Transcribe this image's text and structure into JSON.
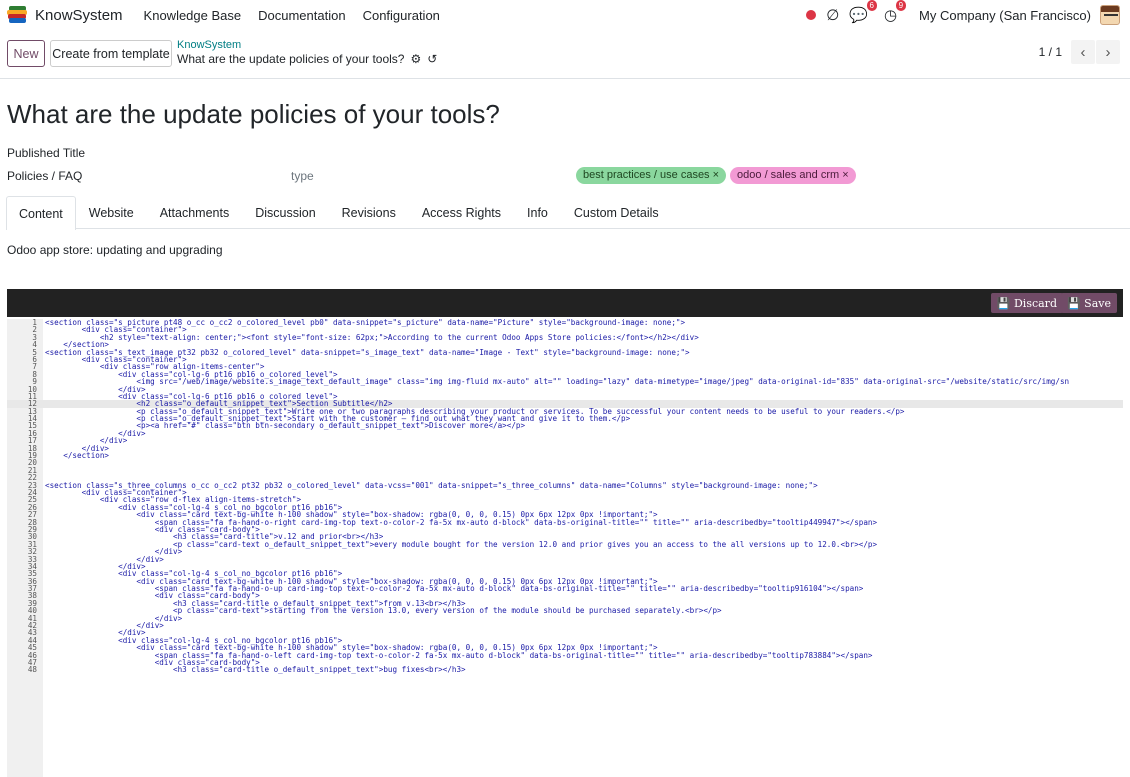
{
  "navbar": {
    "brand": "KnowSystem",
    "menu": [
      "Knowledge Base",
      "Documentation",
      "Configuration"
    ],
    "chat_badge": "6",
    "activity_badge": "9",
    "company": "My Company (San Francisco)"
  },
  "control": {
    "new_label": "New",
    "template_label": "Create from template",
    "breadcrumb_parent": "KnowSystem",
    "breadcrumb_current": "What are the update policies of your tools?",
    "pager_value": "1 / 1"
  },
  "form": {
    "title": "What are the update policies of your tools?",
    "published_label": "Published Title",
    "category": "Policies / FAQ",
    "type_placeholder": "type",
    "tags": [
      "best practices / use cases ×",
      "odoo / sales and crm ×"
    ]
  },
  "tabs": [
    "Content",
    "Website",
    "Attachments",
    "Discussion",
    "Revisions",
    "Access Rights",
    "Info",
    "Custom Details"
  ],
  "content": {
    "intro": "Odoo app store: updating and upgrading"
  },
  "editor": {
    "discard_label": "Discard",
    "save_label": "Save",
    "lines": [
      "<section class=\"s_picture pt48 o_cc o_cc2 o_colored_level pb0\" data-snippet=\"s_picture\" data-name=\"Picture\" style=\"background-image: none;\">",
      "        <div class=\"container\">",
      "            <h2 style=\"text-align: center;\"><font style=\"font-size: 62px;\">According to the current Odoo Apps Store policies:</font></h2></div>",
      "    </section>",
      "<section class=\"s_text_image pt32 pb32 o_colored_level\" data-snippet=\"s_image_text\" data-name=\"Image - Text\" style=\"background-image: none;\">",
      "        <div class=\"container\">",
      "            <div class=\"row align-items-center\">",
      "                <div class=\"col-lg-6 pt16 pb16 o_colored_level\">",
      "                    <img src=\"/web/image/website.s_image_text_default_image\" class=\"img img-fluid mx-auto\" alt=\"\" loading=\"lazy\" data-mimetype=\"image/jpeg\" data-original-id=\"835\" data-original-src=\"/website/static/src/img/sn",
      "                </div>",
      "                <div class=\"col-lg-6 pt16 pb16 o_colored_level\">",
      "                    <h2 class=\"o_default_snippet_text\">Section Subtitle</h2>",
      "                    <p class=\"o_default_snippet_text\">Write one or two paragraphs describing your product or services. To be successful your content needs to be useful to your readers.</p>",
      "                    <p class=\"o_default_snippet_text\">Start with the customer – find out what they want and give it to them.</p>",
      "                    <p><a href=\"#\" class=\"btn btn-secondary o_default_snippet_text\">Discover more</a></p>",
      "                </div>",
      "            </div>",
      "        </div>",
      "    </section>",
      "",
      "",
      "",
      "<section class=\"s_three_columns o_cc o_cc2 pt32 pb32 o_colored_level\" data-vcss=\"001\" data-snippet=\"s_three_columns\" data-name=\"Columns\" style=\"background-image: none;\">",
      "        <div class=\"container\">",
      "            <div class=\"row d-flex align-items-stretch\">",
      "                <div class=\"col-lg-4 s_col_no_bgcolor pt16 pb16\">",
      "                    <div class=\"card text-bg-white h-100 shadow\" style=\"box-shadow: rgba(0, 0, 0, 0.15) 0px 6px 12px 0px !important;\">",
      "                        <span class=\"fa fa-hand-o-right card-img-top text-o-color-2 fa-5x mx-auto d-block\" data-bs-original-title=\"\" title=\"\" aria-describedby=\"tooltip449947\"></span>",
      "                        <div class=\"card-body\">",
      "                            <h3 class=\"card-title\">v.12 and prior<br></h3>",
      "                            <p class=\"card-text o_default_snippet_text\">every module bought for the version 12.0 and prior gives you an access to the all versions up to 12.0.<br></p>",
      "                        </div>",
      "                    </div>",
      "                </div>",
      "                <div class=\"col-lg-4 s_col_no_bgcolor pt16 pb16\">",
      "                    <div class=\"card text-bg-white h-100 shadow\" style=\"box-shadow: rgba(0, 0, 0, 0.15) 0px 6px 12px 0px !important;\">",
      "                        <span class=\"fa fa-hand-o-up card-img-top text-o-color-2 fa-5x mx-auto d-block\" data-bs-original-title=\"\" title=\"\" aria-describedby=\"tooltip916104\"></span>",
      "                        <div class=\"card-body\">",
      "                            <h3 class=\"card-title o_default_snippet_text\">from v.13<br></h3>",
      "                            <p class=\"card-text\">starting from the version 13.0, every version of the module should be purchased separately.<br></p>",
      "                        </div>",
      "                    </div>",
      "                </div>",
      "                <div class=\"col-lg-4 s_col_no_bgcolor pt16 pb16\">",
      "                    <div class=\"card text-bg-white h-100 shadow\" style=\"box-shadow: rgba(0, 0, 0, 0.15) 0px 6px 12px 0px !important;\">",
      "                        <span class=\"fa fa-hand-o-left card-img-top text-o-color-2 fa-5x mx-auto d-block\" data-bs-original-title=\"\" title=\"\" aria-describedby=\"tooltip783884\"></span>",
      "                        <div class=\"card-body\">",
      "                            <h3 class=\"card-title o_default_snippet_text\">bug fixes<br></h3>"
    ]
  }
}
